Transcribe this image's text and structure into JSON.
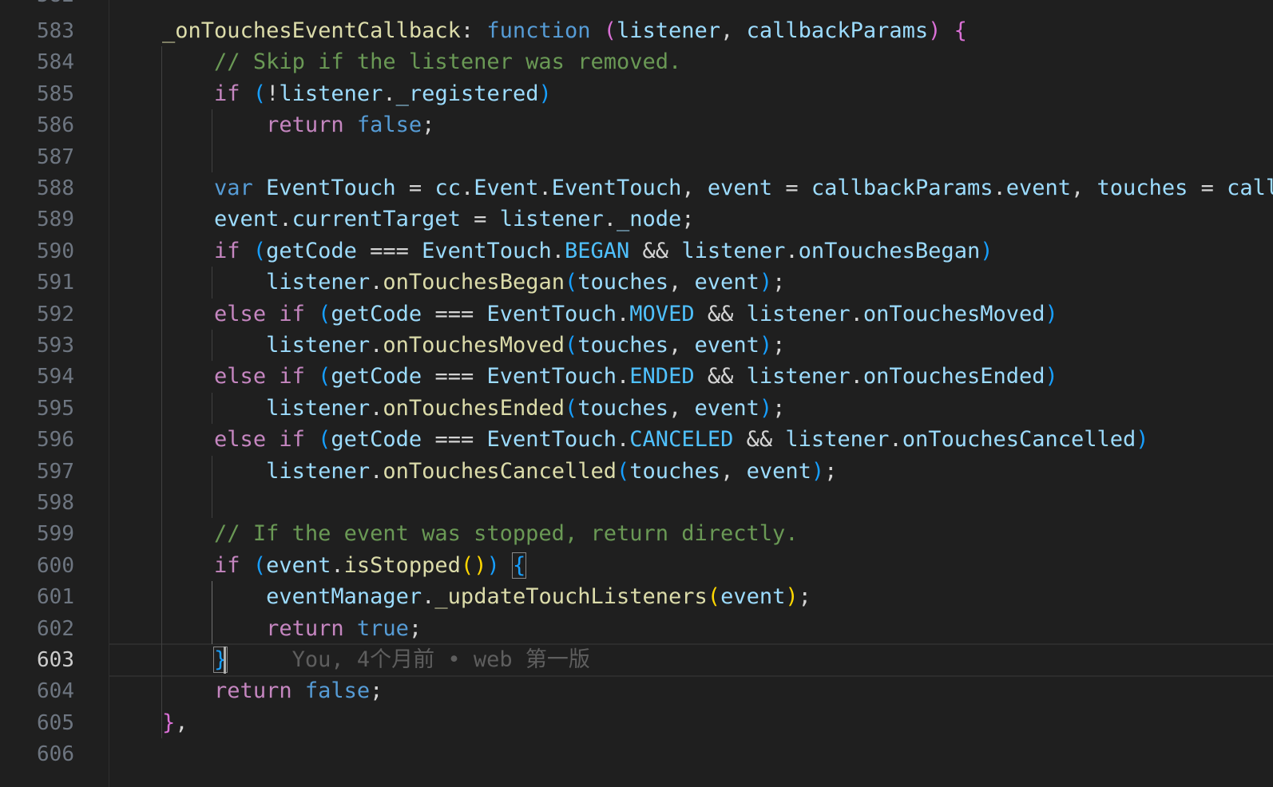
{
  "editor": {
    "first_line_partial": "582",
    "active_line": 603,
    "lines": [
      {
        "num": "583",
        "indent": 0,
        "tokens": [
          [
            "    ",
            "t-plain"
          ],
          [
            "_onTouchesEventCallback",
            "t-fn"
          ],
          [
            ": ",
            "t-plain"
          ],
          [
            "function",
            "t-kw"
          ],
          [
            " ",
            "t-plain"
          ],
          [
            "(",
            "t-b2"
          ],
          [
            "listener",
            "t-var"
          ],
          [
            ", ",
            "t-plain"
          ],
          [
            "callbackParams",
            "t-var"
          ],
          [
            ")",
            "t-b2"
          ],
          [
            " ",
            "t-plain"
          ],
          [
            "{",
            "t-b2"
          ]
        ]
      },
      {
        "num": "584",
        "tokens": [
          [
            "        ",
            "t-plain"
          ],
          [
            "// Skip if the listener was removed.",
            "t-com"
          ]
        ]
      },
      {
        "num": "585",
        "tokens": [
          [
            "        ",
            "t-plain"
          ],
          [
            "if",
            "t-ctrl"
          ],
          [
            " ",
            "t-plain"
          ],
          [
            "(",
            "t-b3"
          ],
          [
            "!",
            "t-plain"
          ],
          [
            "listener",
            "t-var"
          ],
          [
            ".",
            "t-plain"
          ],
          [
            "_registered",
            "t-var"
          ],
          [
            ")",
            "t-b3"
          ]
        ]
      },
      {
        "num": "586",
        "tokens": [
          [
            "            ",
            "t-plain"
          ],
          [
            "return",
            "t-ctrl"
          ],
          [
            " ",
            "t-plain"
          ],
          [
            "false",
            "t-kw"
          ],
          [
            ";",
            "t-plain"
          ]
        ]
      },
      {
        "num": "587",
        "tokens": []
      },
      {
        "num": "588",
        "tokens": [
          [
            "        ",
            "t-plain"
          ],
          [
            "var",
            "t-kw"
          ],
          [
            " ",
            "t-plain"
          ],
          [
            "EventTouch",
            "t-var"
          ],
          [
            " = ",
            "t-plain"
          ],
          [
            "cc",
            "t-var"
          ],
          [
            ".",
            "t-plain"
          ],
          [
            "Event",
            "t-var"
          ],
          [
            ".",
            "t-plain"
          ],
          [
            "EventTouch",
            "t-var"
          ],
          [
            ", ",
            "t-plain"
          ],
          [
            "event",
            "t-var"
          ],
          [
            " = ",
            "t-plain"
          ],
          [
            "callbackParams",
            "t-var"
          ],
          [
            ".",
            "t-plain"
          ],
          [
            "event",
            "t-var"
          ],
          [
            ", ",
            "t-plain"
          ],
          [
            "touches",
            "t-var"
          ],
          [
            " = ",
            "t-plain"
          ],
          [
            "callb",
            "t-var"
          ]
        ]
      },
      {
        "num": "589",
        "tokens": [
          [
            "        ",
            "t-plain"
          ],
          [
            "event",
            "t-var"
          ],
          [
            ".",
            "t-plain"
          ],
          [
            "currentTarget",
            "t-var"
          ],
          [
            " = ",
            "t-plain"
          ],
          [
            "listener",
            "t-var"
          ],
          [
            ".",
            "t-plain"
          ],
          [
            "_node",
            "t-var"
          ],
          [
            ";",
            "t-plain"
          ]
        ]
      },
      {
        "num": "590",
        "tokens": [
          [
            "        ",
            "t-plain"
          ],
          [
            "if",
            "t-ctrl"
          ],
          [
            " ",
            "t-plain"
          ],
          [
            "(",
            "t-b3"
          ],
          [
            "getCode",
            "t-var"
          ],
          [
            " === ",
            "t-plain"
          ],
          [
            "EventTouch",
            "t-var"
          ],
          [
            ".",
            "t-plain"
          ],
          [
            "BEGAN",
            "t-const"
          ],
          [
            " && ",
            "t-plain"
          ],
          [
            "listener",
            "t-var"
          ],
          [
            ".",
            "t-plain"
          ],
          [
            "onTouchesBegan",
            "t-var"
          ],
          [
            ")",
            "t-b3"
          ]
        ]
      },
      {
        "num": "591",
        "tokens": [
          [
            "            ",
            "t-plain"
          ],
          [
            "listener",
            "t-var"
          ],
          [
            ".",
            "t-plain"
          ],
          [
            "onTouchesBegan",
            "t-fn"
          ],
          [
            "(",
            "t-b3"
          ],
          [
            "touches",
            "t-var"
          ],
          [
            ", ",
            "t-plain"
          ],
          [
            "event",
            "t-var"
          ],
          [
            ")",
            "t-b3"
          ],
          [
            ";",
            "t-plain"
          ]
        ]
      },
      {
        "num": "592",
        "tokens": [
          [
            "        ",
            "t-plain"
          ],
          [
            "else",
            "t-ctrl"
          ],
          [
            " ",
            "t-plain"
          ],
          [
            "if",
            "t-ctrl"
          ],
          [
            " ",
            "t-plain"
          ],
          [
            "(",
            "t-b3"
          ],
          [
            "getCode",
            "t-var"
          ],
          [
            " === ",
            "t-plain"
          ],
          [
            "EventTouch",
            "t-var"
          ],
          [
            ".",
            "t-plain"
          ],
          [
            "MOVED",
            "t-const"
          ],
          [
            " && ",
            "t-plain"
          ],
          [
            "listener",
            "t-var"
          ],
          [
            ".",
            "t-plain"
          ],
          [
            "onTouchesMoved",
            "t-var"
          ],
          [
            ")",
            "t-b3"
          ]
        ]
      },
      {
        "num": "593",
        "tokens": [
          [
            "            ",
            "t-plain"
          ],
          [
            "listener",
            "t-var"
          ],
          [
            ".",
            "t-plain"
          ],
          [
            "onTouchesMoved",
            "t-fn"
          ],
          [
            "(",
            "t-b3"
          ],
          [
            "touches",
            "t-var"
          ],
          [
            ", ",
            "t-plain"
          ],
          [
            "event",
            "t-var"
          ],
          [
            ")",
            "t-b3"
          ],
          [
            ";",
            "t-plain"
          ]
        ]
      },
      {
        "num": "594",
        "tokens": [
          [
            "        ",
            "t-plain"
          ],
          [
            "else",
            "t-ctrl"
          ],
          [
            " ",
            "t-plain"
          ],
          [
            "if",
            "t-ctrl"
          ],
          [
            " ",
            "t-plain"
          ],
          [
            "(",
            "t-b3"
          ],
          [
            "getCode",
            "t-var"
          ],
          [
            " === ",
            "t-plain"
          ],
          [
            "EventTouch",
            "t-var"
          ],
          [
            ".",
            "t-plain"
          ],
          [
            "ENDED",
            "t-const"
          ],
          [
            " && ",
            "t-plain"
          ],
          [
            "listener",
            "t-var"
          ],
          [
            ".",
            "t-plain"
          ],
          [
            "onTouchesEnded",
            "t-var"
          ],
          [
            ")",
            "t-b3"
          ]
        ]
      },
      {
        "num": "595",
        "tokens": [
          [
            "            ",
            "t-plain"
          ],
          [
            "listener",
            "t-var"
          ],
          [
            ".",
            "t-plain"
          ],
          [
            "onTouchesEnded",
            "t-fn"
          ],
          [
            "(",
            "t-b3"
          ],
          [
            "touches",
            "t-var"
          ],
          [
            ", ",
            "t-plain"
          ],
          [
            "event",
            "t-var"
          ],
          [
            ")",
            "t-b3"
          ],
          [
            ";",
            "t-plain"
          ]
        ]
      },
      {
        "num": "596",
        "tokens": [
          [
            "        ",
            "t-plain"
          ],
          [
            "else",
            "t-ctrl"
          ],
          [
            " ",
            "t-plain"
          ],
          [
            "if",
            "t-ctrl"
          ],
          [
            " ",
            "t-plain"
          ],
          [
            "(",
            "t-b3"
          ],
          [
            "getCode",
            "t-var"
          ],
          [
            " === ",
            "t-plain"
          ],
          [
            "EventTouch",
            "t-var"
          ],
          [
            ".",
            "t-plain"
          ],
          [
            "CANCELED",
            "t-const"
          ],
          [
            " && ",
            "t-plain"
          ],
          [
            "listener",
            "t-var"
          ],
          [
            ".",
            "t-plain"
          ],
          [
            "onTouchesCancelled",
            "t-var"
          ],
          [
            ")",
            "t-b3"
          ]
        ]
      },
      {
        "num": "597",
        "tokens": [
          [
            "            ",
            "t-plain"
          ],
          [
            "listener",
            "t-var"
          ],
          [
            ".",
            "t-plain"
          ],
          [
            "onTouchesCancelled",
            "t-fn"
          ],
          [
            "(",
            "t-b3"
          ],
          [
            "touches",
            "t-var"
          ],
          [
            ", ",
            "t-plain"
          ],
          [
            "event",
            "t-var"
          ],
          [
            ")",
            "t-b3"
          ],
          [
            ";",
            "t-plain"
          ]
        ]
      },
      {
        "num": "598",
        "tokens": []
      },
      {
        "num": "599",
        "tokens": [
          [
            "        ",
            "t-plain"
          ],
          [
            "// If the event was stopped, return directly.",
            "t-com"
          ]
        ]
      },
      {
        "num": "600",
        "tokens": [
          [
            "        ",
            "t-plain"
          ],
          [
            "if",
            "t-ctrl"
          ],
          [
            " ",
            "t-plain"
          ],
          [
            "(",
            "t-b3"
          ],
          [
            "event",
            "t-var"
          ],
          [
            ".",
            "t-plain"
          ],
          [
            "isStopped",
            "t-fn"
          ],
          [
            "(",
            "t-b1"
          ],
          [
            ")",
            "t-b1"
          ],
          [
            ")",
            "t-b3"
          ],
          [
            " ",
            "t-plain"
          ],
          [
            "{",
            "t-bx"
          ]
        ]
      },
      {
        "num": "601",
        "tokens": [
          [
            "            ",
            "t-plain"
          ],
          [
            "eventManager",
            "t-var"
          ],
          [
            ".",
            "t-plain"
          ],
          [
            "_updateTouchListeners",
            "t-fn"
          ],
          [
            "(",
            "t-b1"
          ],
          [
            "event",
            "t-var"
          ],
          [
            ")",
            "t-b1"
          ],
          [
            ";",
            "t-plain"
          ]
        ]
      },
      {
        "num": "602",
        "tokens": [
          [
            "            ",
            "t-plain"
          ],
          [
            "return",
            "t-ctrl"
          ],
          [
            " ",
            "t-plain"
          ],
          [
            "true",
            "t-kw"
          ],
          [
            ";",
            "t-plain"
          ]
        ]
      },
      {
        "num": "603",
        "tokens": [
          [
            "        ",
            "t-plain"
          ],
          [
            "}",
            "t-bx"
          ],
          [
            "     ",
            "t-plain"
          ],
          [
            "You, 4个月前 • web 第一版",
            "blame"
          ]
        ]
      },
      {
        "num": "604",
        "tokens": [
          [
            "        ",
            "t-plain"
          ],
          [
            "return",
            "t-ctrl"
          ],
          [
            " ",
            "t-plain"
          ],
          [
            "false",
            "t-kw"
          ],
          [
            ";",
            "t-plain"
          ]
        ]
      },
      {
        "num": "605",
        "tokens": [
          [
            "    ",
            "t-plain"
          ],
          [
            "}",
            "t-b2"
          ],
          [
            ",",
            "t-plain"
          ]
        ]
      },
      {
        "num": "606",
        "tokens": []
      }
    ]
  }
}
